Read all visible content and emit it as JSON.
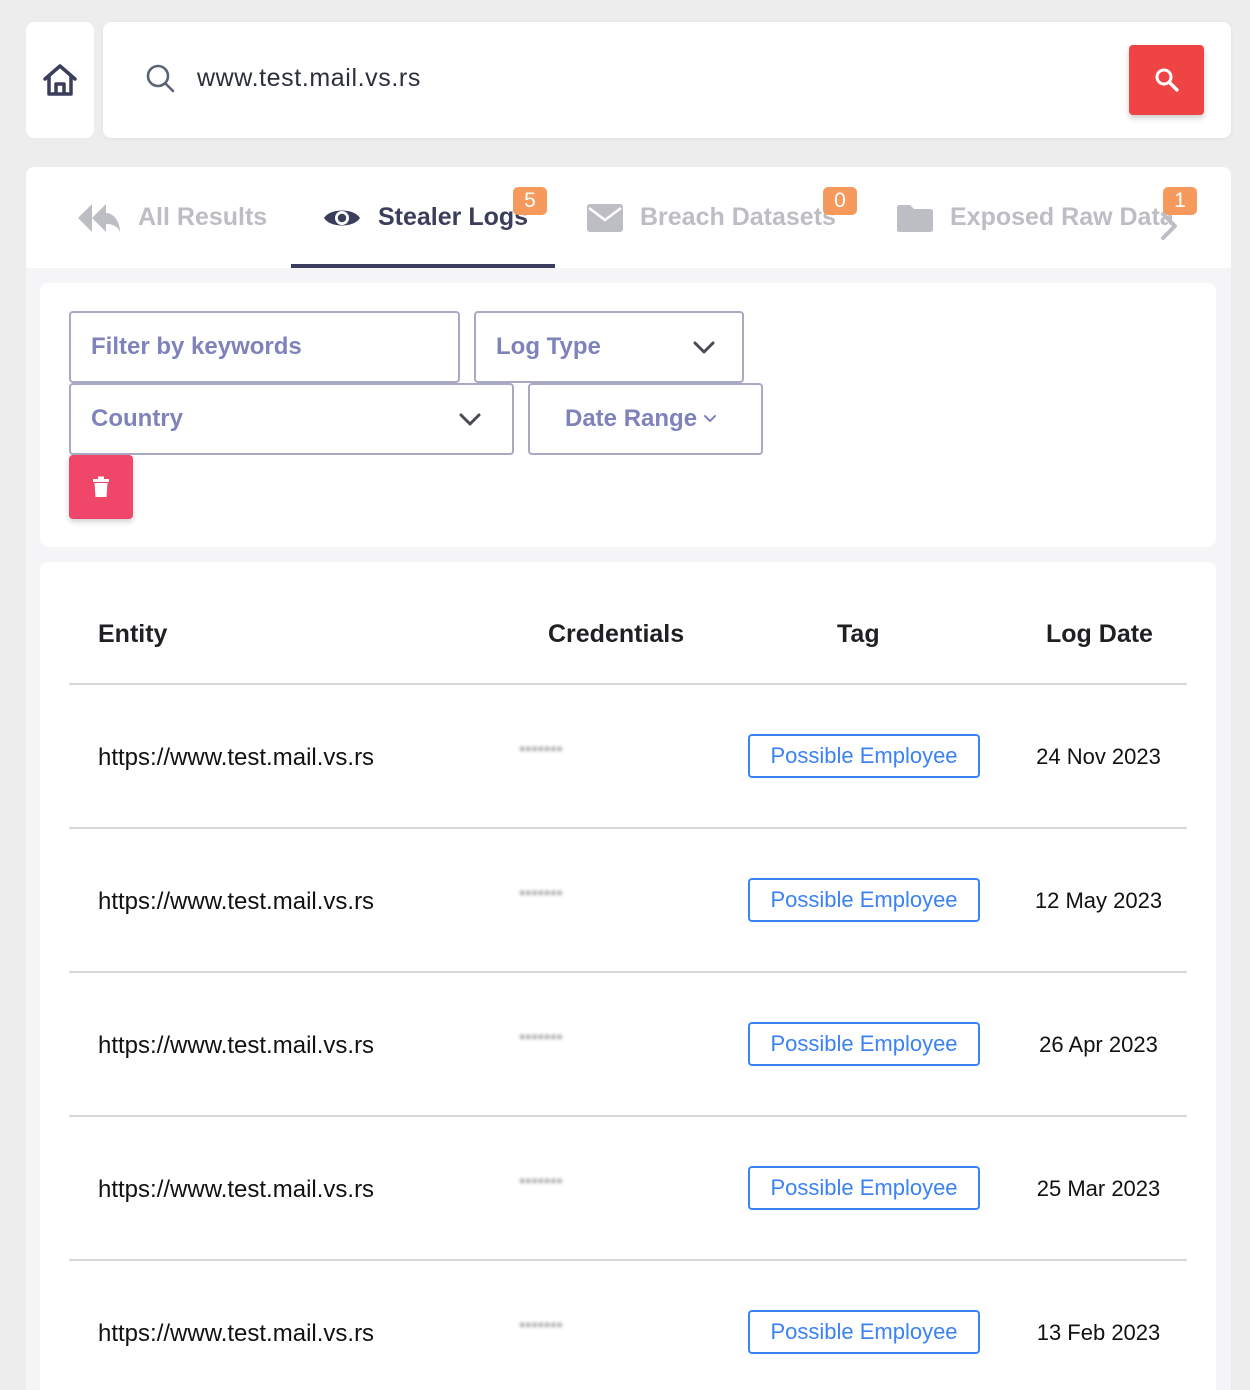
{
  "search": {
    "query": "www.test.mail.vs.rs"
  },
  "tabs": [
    {
      "label": "All Results",
      "icon": "double-back-arrow-icon",
      "badge": null,
      "active": false
    },
    {
      "label": "Stealer Logs",
      "icon": "eye-icon",
      "badge": "5",
      "active": true
    },
    {
      "label": "Breach Datasets",
      "icon": "envelope-icon",
      "badge": "0",
      "active": false
    },
    {
      "label": "Exposed Raw Data",
      "icon": "folder-icon",
      "badge": "1",
      "active": false
    }
  ],
  "filters": {
    "keywords_placeholder": "Filter by keywords",
    "log_type_label": "Log Type",
    "country_label": "Country",
    "date_range_label": "Date Range"
  },
  "table": {
    "headers": [
      "Entity",
      "Credentials",
      "Tag",
      "Log Date"
    ],
    "rows": [
      {
        "entity": "https://www.test.mail.vs.rs",
        "credentials": "*******",
        "tag": "Possible Employee",
        "date": "24 Nov 2023"
      },
      {
        "entity": "https://www.test.mail.vs.rs",
        "credentials": "*******",
        "tag": "Possible Employee",
        "date": "12 May 2023"
      },
      {
        "entity": "https://www.test.mail.vs.rs",
        "credentials": "*******",
        "tag": "Possible Employee",
        "date": "26 Apr 2023"
      },
      {
        "entity": "https://www.test.mail.vs.rs",
        "credentials": "*******",
        "tag": "Possible Employee",
        "date": "25 Mar 2023"
      },
      {
        "entity": "https://www.test.mail.vs.rs",
        "credentials": "*******",
        "tag": "Possible Employee",
        "date": "13 Feb 2023"
      }
    ]
  },
  "colors": {
    "accent_dark": "#3b3d5c",
    "search_button": "#ef4444",
    "delete_button": "#f0466a",
    "badge": "#f59a5c",
    "tag": "#3b82f6"
  }
}
